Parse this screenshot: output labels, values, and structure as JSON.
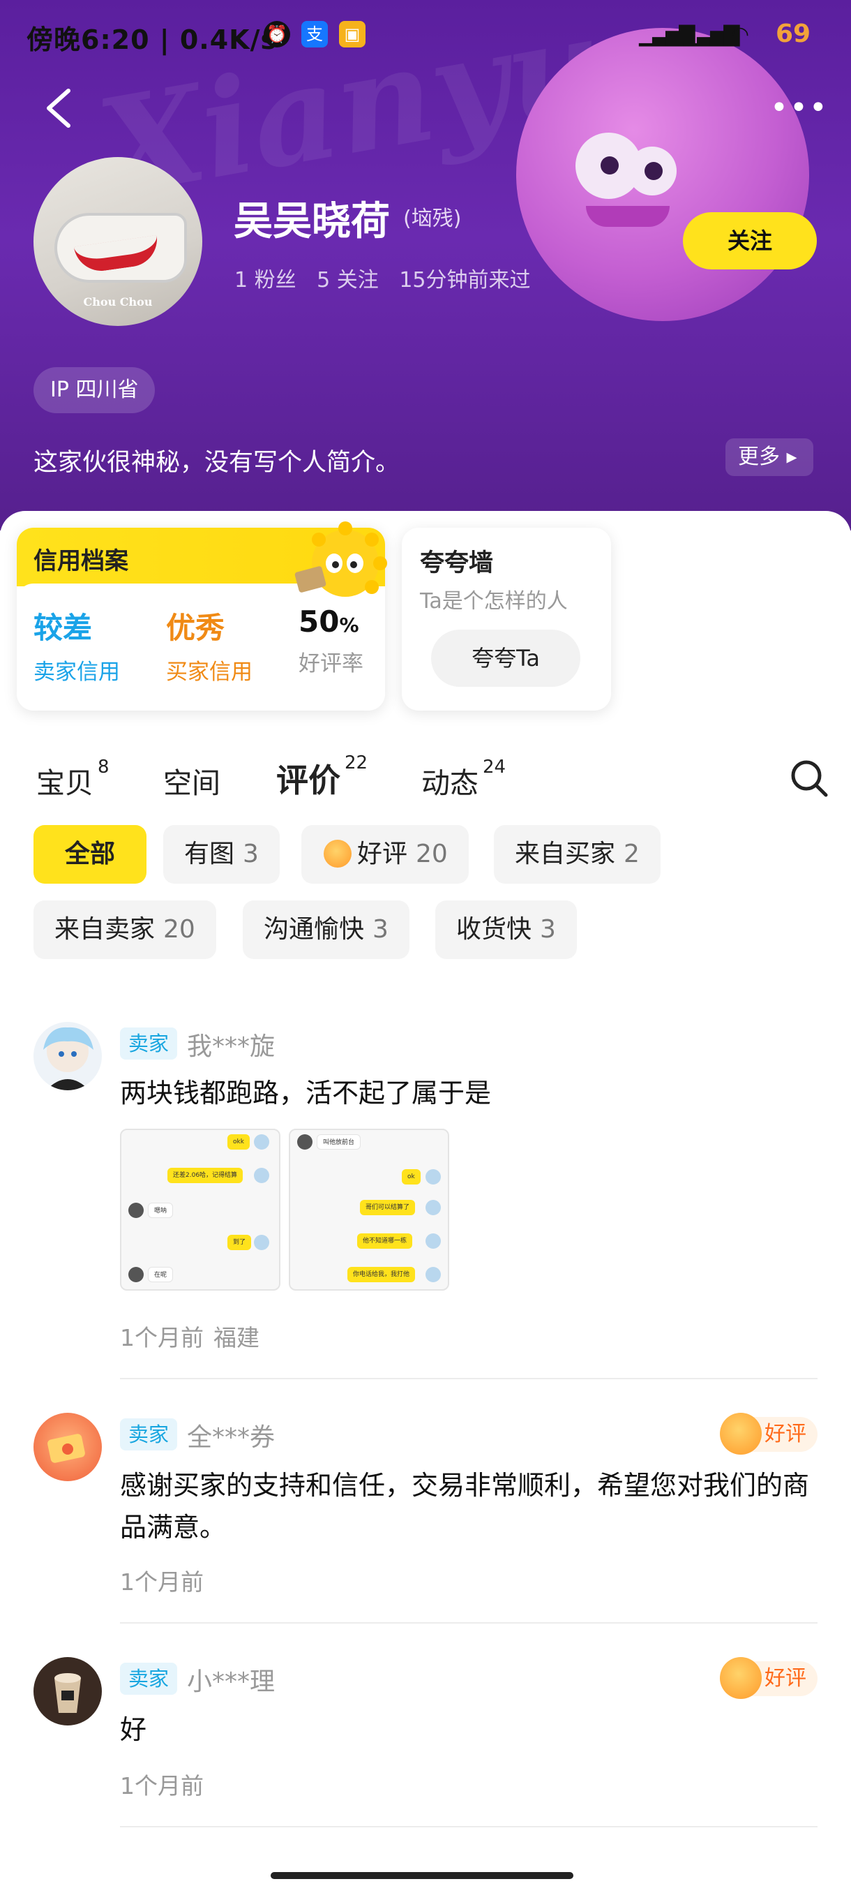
{
  "status_bar": {
    "time": "傍晚6:20 | 0.4K/s",
    "battery": "69"
  },
  "header": {
    "watermark": "Xianyu",
    "avatar_caption": "Chou Chou",
    "name": "吴吴晓荷",
    "name_tag": "(垴残)",
    "stats": [
      "1 粉丝",
      "5 关注",
      "15分钟前来过"
    ],
    "follow_label": "关注",
    "ip": "IP 四川省",
    "bio": "这家伙很神秘，没有写个人简介。",
    "more_label": "更多"
  },
  "credit": {
    "title": "信用档案",
    "seller": {
      "value": "较差",
      "label": "卖家信用",
      "color": "#1aa3e8"
    },
    "buyer": {
      "value": "优秀",
      "label": "买家信用",
      "color": "#f08a15"
    },
    "rate": {
      "value": "50",
      "unit": "%",
      "label": "好评率"
    }
  },
  "praise": {
    "title": "夸夸墙",
    "subtitle": "Ta是个怎样的人",
    "button": "夸夸Ta"
  },
  "tabs": [
    {
      "label": "宝贝",
      "count": "8"
    },
    {
      "label": "空间",
      "count": ""
    },
    {
      "label": "评价",
      "count": "22"
    },
    {
      "label": "动态",
      "count": "24"
    }
  ],
  "filters": [
    {
      "label": "全部",
      "count": ""
    },
    {
      "label": "有图",
      "count": "3"
    },
    {
      "label": "好评",
      "count": "20"
    },
    {
      "label": "来自买家",
      "count": "2"
    },
    {
      "label": "来自卖家",
      "count": "20"
    },
    {
      "label": "沟通愉快",
      "count": "3"
    },
    {
      "label": "收货快",
      "count": "3"
    }
  ],
  "reviews": [
    {
      "role": "卖家",
      "user": "我***旋",
      "text": "两块钱都跑路，活不起了属于是",
      "time": "1个月前",
      "location": "福建",
      "badge": ""
    },
    {
      "role": "卖家",
      "user": "全***券",
      "text": "感谢买家的支持和信任，交易非常顺利，希望您对我们的商品满意。",
      "time": "1个月前",
      "location": "",
      "badge": "好评"
    },
    {
      "role": "卖家",
      "user": "小***理",
      "text": "好",
      "time": "1个月前",
      "location": "",
      "badge": "好评"
    }
  ],
  "screenshots": [
    {
      "bubbles": [
        "okk",
        "还差2.06哈，记得结算",
        "嗯呐",
        "到了",
        "在呢"
      ]
    },
    {
      "bubbles": [
        "叫他放前台",
        "ok",
        "哥们可以结算了",
        "他不知道哪一栋",
        "你电话给我，我打他"
      ]
    }
  ]
}
